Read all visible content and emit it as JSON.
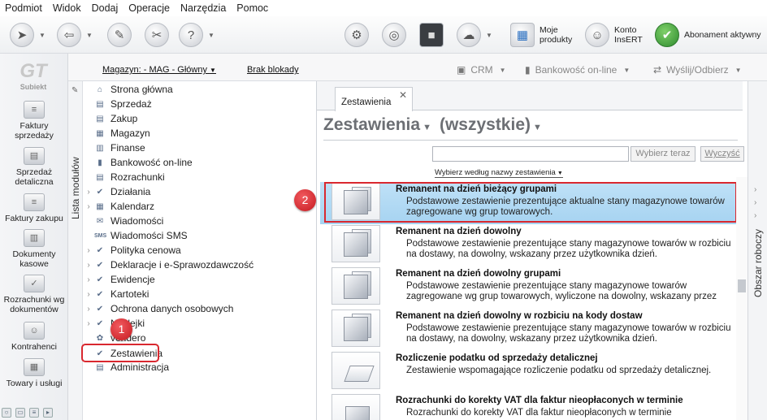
{
  "menu": [
    "Podmiot",
    "Widok",
    "Dodaj",
    "Operacje",
    "Narzędzia",
    "Pomoc"
  ],
  "toolbar": {
    "moje_produkty": "Moje produkty",
    "konto": "Konto InsERT",
    "abonament": "Abonament aktywny"
  },
  "sidebar": {
    "logo": "Subiekt",
    "items": [
      {
        "label": "Faktury sprzedaży",
        "icon": "coins-icon"
      },
      {
        "label": "Sprzedaż detaliczna",
        "icon": "register-icon"
      },
      {
        "label": "Faktury zakupu",
        "icon": "coins-icon"
      },
      {
        "label": "Dokumenty kasowe",
        "icon": "cash-icon"
      },
      {
        "label": "Rozrachunki wg dokumentów",
        "icon": "document-icon"
      },
      {
        "label": "Kontrahenci",
        "icon": "person-icon"
      },
      {
        "label": "Towary i usługi",
        "icon": "boxes-icon"
      }
    ]
  },
  "magbar": {
    "magazyn": "Magazyn: - MAG - Główny",
    "blokada": "Brak blokady",
    "crm": "CRM",
    "bankowosc": "Bankowość on-line",
    "wyslij": "Wyślij/Odbierz"
  },
  "modules": {
    "vertical_label": "Lista modułów",
    "items": [
      {
        "label": "Strona główna",
        "arrow": false
      },
      {
        "label": "Sprzedaż",
        "arrow": false
      },
      {
        "label": "Zakup",
        "arrow": false
      },
      {
        "label": "Magazyn",
        "arrow": false
      },
      {
        "label": "Finanse",
        "arrow": false
      },
      {
        "label": "Bankowość on-line",
        "arrow": false
      },
      {
        "label": "Rozrachunki",
        "arrow": false
      },
      {
        "label": "Działania",
        "arrow": true
      },
      {
        "label": "Kalendarz",
        "arrow": true
      },
      {
        "label": "Wiadomości",
        "arrow": false
      },
      {
        "label": "Wiadomości SMS",
        "arrow": false
      },
      {
        "label": "Polityka cenowa",
        "arrow": true
      },
      {
        "label": "Deklaracje i e-Sprawozdawczość",
        "arrow": true
      },
      {
        "label": "Ewidencje",
        "arrow": true
      },
      {
        "label": "Kartoteki",
        "arrow": true
      },
      {
        "label": "Ochrona danych osobowych",
        "arrow": true
      },
      {
        "label": "Naklejki",
        "arrow": true
      },
      {
        "label": "vendero",
        "arrow": false
      },
      {
        "label": "Zestawienia",
        "arrow": false
      },
      {
        "label": "Administracja",
        "arrow": false
      }
    ]
  },
  "badges": {
    "one": "1",
    "two": "2"
  },
  "panel": {
    "tab": "Zestawienia",
    "title": "Zestawienia",
    "filter": "(wszystkie)",
    "search_value": "",
    "search_btn": "Wybierz teraz",
    "clear_btn": "Wyczyść",
    "sort_label": "Wybierz według nazwy zestawienia"
  },
  "reports": [
    {
      "title": "Remanent na dzień bieżący grupami",
      "desc": "Podstawowe zestawienie prezentujące aktualne stany magazynowe towarów zagregowane wg grup towarowych.",
      "selected": true
    },
    {
      "title": "Remanent na dzień dowolny",
      "desc": "Podstawowe zestawienie prezentujące stany magazynowe towarów w rozbiciu na dostawy, na dowolny, wskazany przez użytkownika dzień.",
      "selected": false
    },
    {
      "title": "Remanent na dzień dowolny grupami",
      "desc": "Podstawowe zestawienie prezentujące stany magazynowe towarów zagregowane wg grup towarowych, wyliczone na dowolny, wskazany przez",
      "selected": false
    },
    {
      "title": "Remanent na dzień dowolny w rozbiciu na kody dostaw",
      "desc": "Podstawowe zestawienie prezentujące stany magazynowe towarów w rozbiciu na dostawy, na dowolny, wskazany przez użytkownika dzień.",
      "selected": false
    },
    {
      "title": "Rozliczenie podatku od sprzedaży detalicznej",
      "desc": "Zestawienie wspomagające rozliczenie podatku od sprzedaży detalicznej.",
      "selected": false
    },
    {
      "title": "Rozrachunki do korekty VAT dla faktur nieopłaconych w terminie",
      "desc": "Rozrachunki do korekty VAT dla faktur nieopłaconych w terminie",
      "selected": false
    }
  ],
  "right_strip": {
    "label": "Obszar roboczy"
  }
}
